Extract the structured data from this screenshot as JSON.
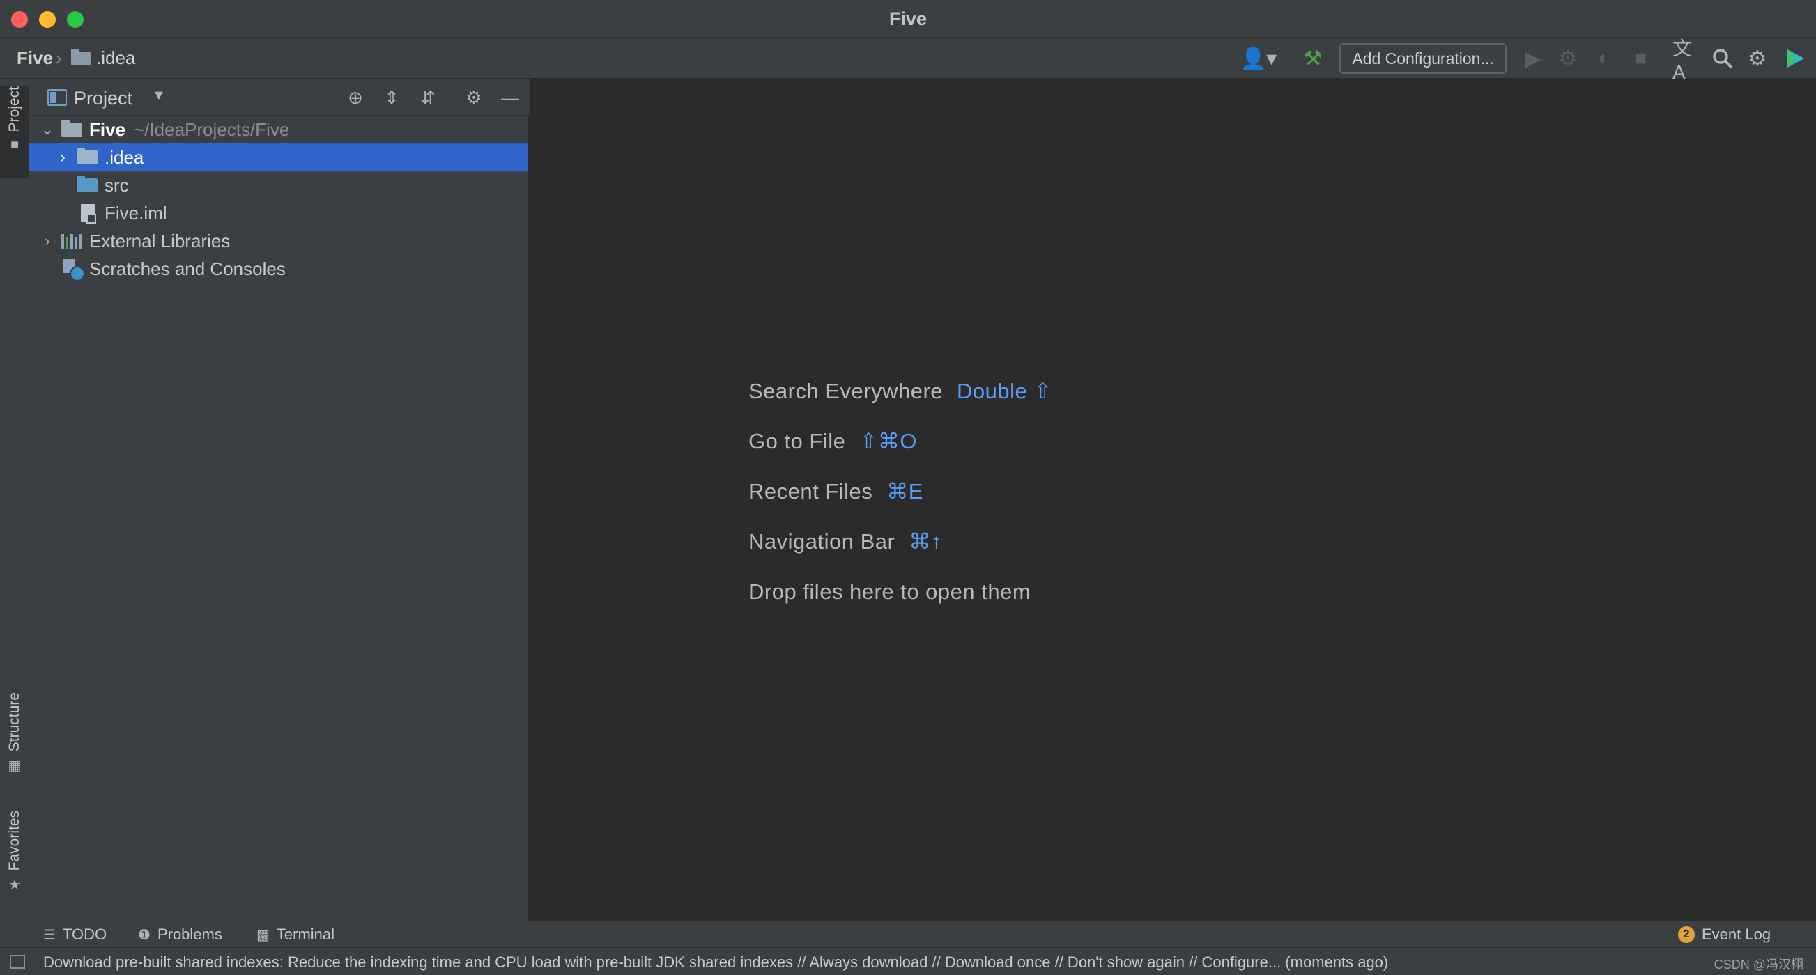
{
  "window": {
    "title": "Five"
  },
  "navbar": {
    "project": "Five",
    "separator": "›",
    "folder": ".idea",
    "add_configuration": "Add Configuration..."
  },
  "left_strip": {
    "project": "Project",
    "structure": "Structure",
    "favorites": "Favorites"
  },
  "project_panel": {
    "title": "Project",
    "tree": [
      {
        "label": "Five",
        "path": "~/IdeaProjects/Five",
        "expanded": true
      },
      {
        "label": ".idea",
        "selected": true
      },
      {
        "label": "src"
      },
      {
        "label": "Five.iml"
      },
      {
        "label": "External Libraries"
      },
      {
        "label": "Scratches and Consoles"
      }
    ]
  },
  "editor": {
    "hints": [
      {
        "label": "Search Everywhere",
        "shortcut": "Double ⇧"
      },
      {
        "label": "Go to File",
        "shortcut": "⇧⌘O"
      },
      {
        "label": "Recent Files",
        "shortcut": "⌘E"
      },
      {
        "label": "Navigation Bar",
        "shortcut": "⌘↑"
      },
      {
        "label": "Drop files here to open them",
        "shortcut": ""
      }
    ]
  },
  "bottom_bar": {
    "todo": "TODO",
    "problems": "Problems",
    "terminal": "Terminal",
    "event_log": "Event Log",
    "event_count": "2"
  },
  "status_bar": {
    "message": "Download pre-built shared indexes: Reduce the indexing time and CPU load with pre-built JDK shared indexes // Always download // Download once // Don't show again // Configure... (moments ago)",
    "credit": "CSDN @冯汉栩"
  },
  "colors": {
    "selection": "#2f65ca",
    "shortcut": "#589df6",
    "run_green": "#4ca346",
    "badge": "#e0a43d"
  }
}
